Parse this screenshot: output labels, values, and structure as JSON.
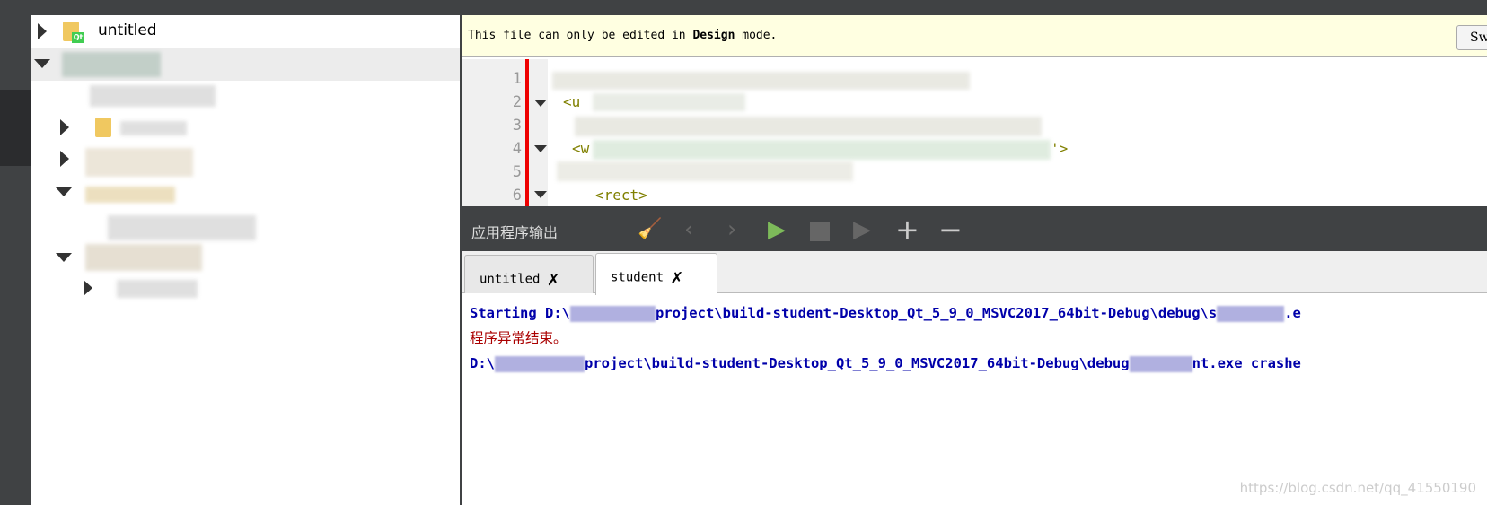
{
  "project_tree": {
    "items": [
      {
        "label": "untitled",
        "expanded": false,
        "icon": "qt-project-folder-icon"
      }
    ]
  },
  "design_notice": {
    "text_before": "This file can only be edited in ",
    "text_bold": "Design",
    "text_after": " mode.",
    "switch_button": "Sw"
  },
  "editor": {
    "line_numbers": [
      "1",
      "2",
      "3",
      "4",
      "5",
      "6"
    ],
    "line6_code": "<rect>",
    "line2_code": "<u",
    "line4_code": "<w",
    "line4_end": "'>"
  },
  "output_pane": {
    "title": "应用程序输出",
    "toolbar_icons": [
      "clear-icon",
      "prev-icon",
      "next-icon",
      "run-icon",
      "stop-icon",
      "debug-icon",
      "zoom-in-icon",
      "zoom-out-icon"
    ],
    "tabs": [
      {
        "label": "untitled",
        "active": false
      },
      {
        "label": "student",
        "active": true
      }
    ],
    "lines": {
      "l1_a": "Starting D:\\",
      "l1_b": "project\\build-student-Desktop_Qt_5_9_0_MSVC2017_64bit-Debug\\debug\\s",
      "l1_c": ".e",
      "l2": "程序异常结束。",
      "l3_a": "D:\\",
      "l3_b": "project\\build-student-Desktop_Qt_5_9_0_MSVC2017_64bit-Debug\\debug",
      "l3_c": "nt.exe crashe"
    },
    "colors": {
      "info": "#0000aa",
      "error": "#aa0000"
    }
  },
  "watermark": "https://blog.csdn.net/qq_41550190"
}
